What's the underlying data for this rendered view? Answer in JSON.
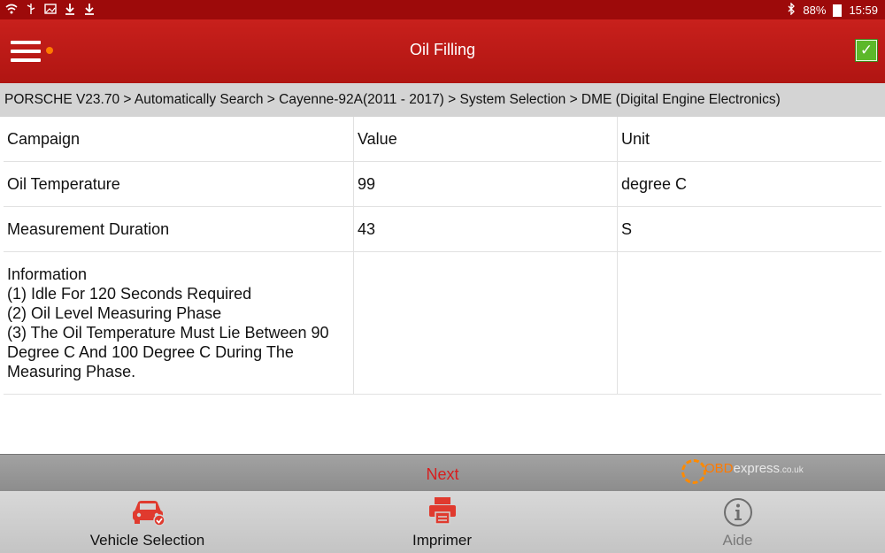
{
  "status_bar": {
    "left_icons": [
      "wifi-icon",
      "usb-icon",
      "image-icon",
      "download-icon",
      "download-icon"
    ],
    "battery": "88%",
    "time": "15:59"
  },
  "header": {
    "title": "Oil Filling",
    "accent_color": "#c0191a"
  },
  "breadcrumb": "PORSCHE V23.70 > Automatically Search > Cayenne-92A(2011 - 2017) > System Selection > DME (Digital Engine Electronics)",
  "table": {
    "columns": [
      "Campaign",
      "Value",
      "Unit"
    ],
    "rows": [
      {
        "campaign": "Oil Temperature",
        "value": "99",
        "unit": "degree C"
      },
      {
        "campaign": "Measurement Duration",
        "value": "43",
        "unit": "S"
      }
    ],
    "info": "Information\n   (1) Idle For 120 Seconds Required\n   (2) Oil Level Measuring Phase\n   (3) The Oil Temperature Must Lie Between 90\nDegree C And 100 Degree C During The\nMeasuring Phase."
  },
  "next_label": "Next",
  "watermark": {
    "brand": "OBD",
    "express": "express",
    "tld": ".co.uk"
  },
  "bottom_nav": [
    {
      "label": "Vehicle Selection",
      "icon": "car-icon"
    },
    {
      "label": "Imprimer",
      "icon": "printer-icon"
    },
    {
      "label": "Aide",
      "icon": "info-icon"
    }
  ]
}
